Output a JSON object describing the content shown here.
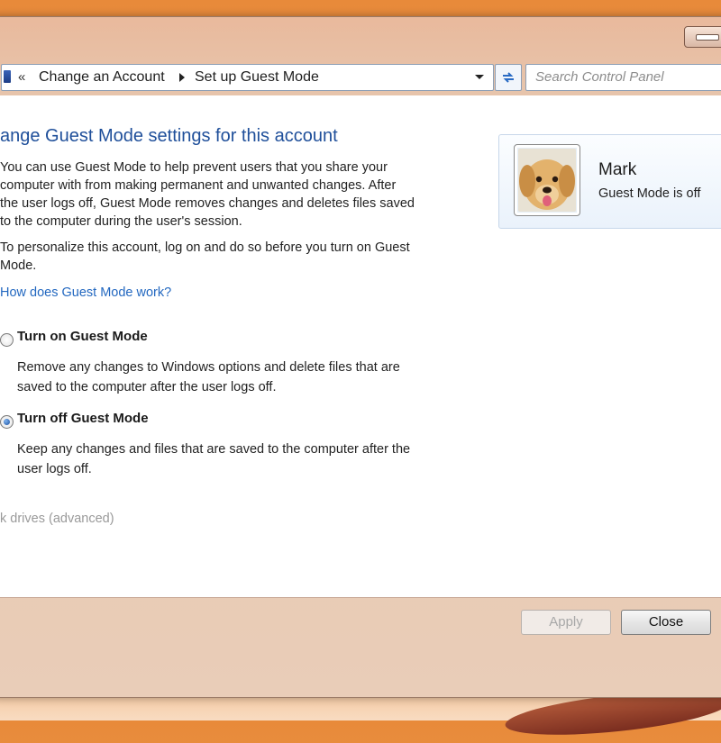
{
  "address_bar": {
    "overflow_glyph": "«",
    "breadcrumbs": [
      {
        "label": "Change an Account"
      },
      {
        "label": "Set up Guest Mode"
      }
    ],
    "search_placeholder": "Search Control Panel"
  },
  "content": {
    "heading": "ange Guest Mode settings for this account",
    "intro_lines": [
      "You can use Guest Mode to help prevent users that you share your",
      "computer with from making permanent and unwanted changes. After",
      "the user logs off, Guest Mode removes changes and deletes files saved",
      "to the computer during the user's session."
    ],
    "personalize_lines": [
      "To personalize this account, log on and do so before you turn on Guest",
      "Mode."
    ],
    "help_link": "How does Guest Mode work?",
    "options": [
      {
        "label": "Turn on Guest Mode",
        "selected": false,
        "description_lines": [
          "Remove any changes to Windows options and delete files that are",
          "saved to the computer after the user logs off."
        ]
      },
      {
        "label": "Turn off Guest Mode",
        "selected": true,
        "description_lines": [
          "Keep any changes and  files that are saved to the computer after the",
          "user logs off."
        ]
      }
    ],
    "advanced_link": "k drives (advanced)"
  },
  "account": {
    "name": "Mark",
    "status": "Guest Mode is off",
    "avatar_icon": "dog-avatar-icon"
  },
  "buttons": {
    "apply": "Apply",
    "close": "Close"
  },
  "colors": {
    "heading": "#1f4f9a",
    "link": "#2368c0"
  }
}
